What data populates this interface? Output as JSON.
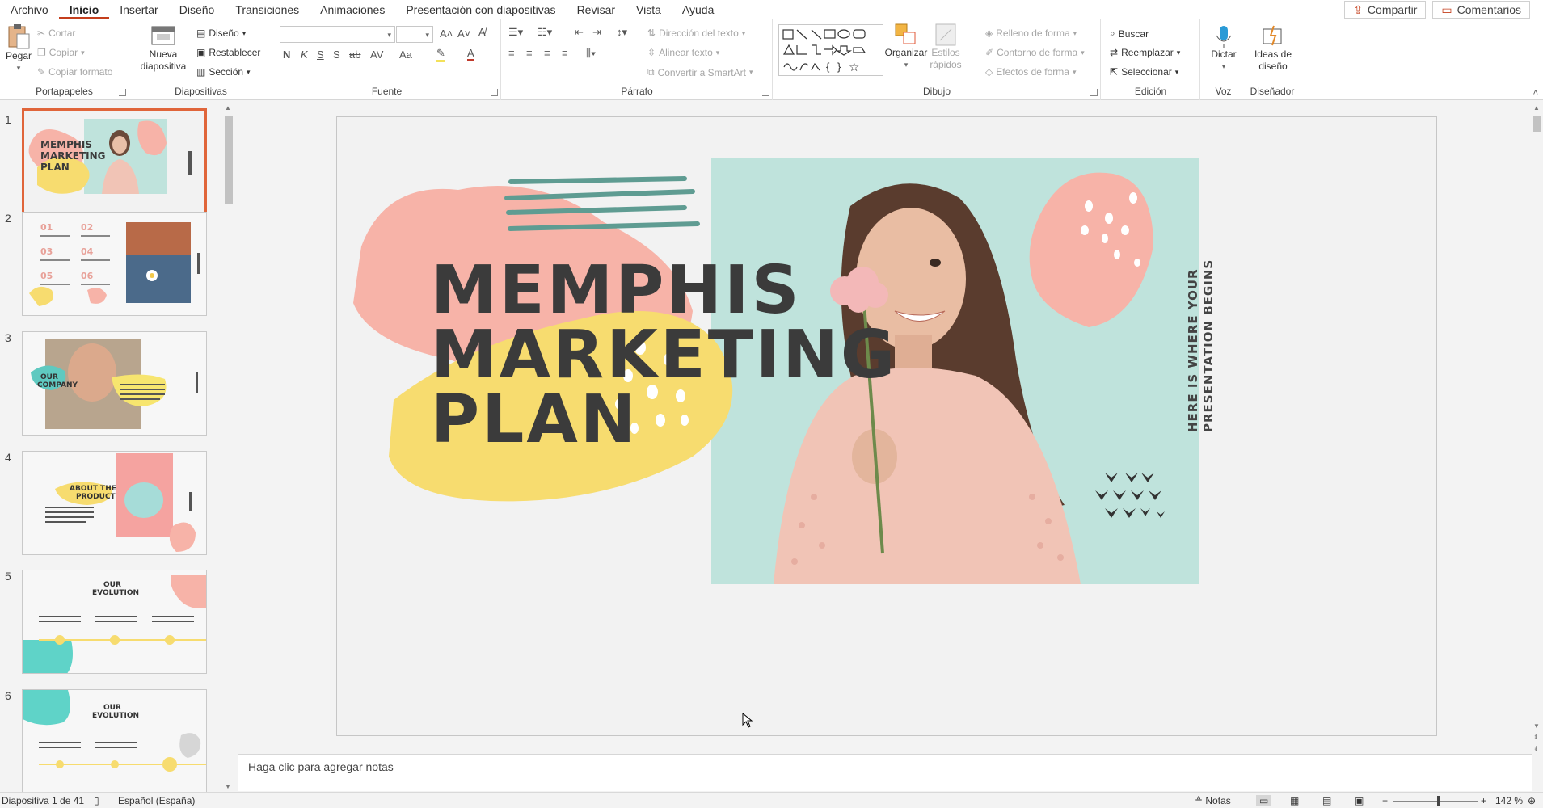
{
  "tabs": [
    "Archivo",
    "Inicio",
    "Insertar",
    "Diseño",
    "Transiciones",
    "Animaciones",
    "Presentación con diapositivas",
    "Revisar",
    "Vista",
    "Ayuda"
  ],
  "active_tab": "Inicio",
  "share": {
    "label": "Compartir",
    "comments": "Comentarios"
  },
  "ribbon": {
    "portapapeles": {
      "label": "Portapapeles",
      "paste": "Pegar",
      "cut": "Cortar",
      "copy": "Copiar",
      "copy_format": "Copiar formato"
    },
    "diapositivas": {
      "label": "Diapositivas",
      "new_slide": "Nueva diapositiva",
      "layout": "Diseño",
      "reset": "Restablecer",
      "section": "Sección"
    },
    "fuente": {
      "label": "Fuente"
    },
    "parrafo": {
      "label": "Párrafo",
      "text_direction": "Dirección del texto",
      "align_text": "Alinear texto",
      "smartart": "Convertir a SmartArt"
    },
    "dibujo": {
      "label": "Dibujo",
      "arrange": "Organizar",
      "quick_styles": "Estilos rápidos",
      "fill": "Relleno de forma",
      "outline": "Contorno de forma",
      "effects": "Efectos de forma"
    },
    "edicion": {
      "label": "Edición",
      "find": "Buscar",
      "replace": "Reemplazar",
      "select": "Seleccionar"
    },
    "voz": {
      "label": "Voz",
      "dictate": "Dictar"
    },
    "disenador": {
      "label": "Diseñador",
      "ideas": "Ideas de diseño"
    }
  },
  "thumbnails": [
    {
      "num": "1",
      "text": "MEMPHIS MARKETING PLAN"
    },
    {
      "num": "2",
      "text": ""
    },
    {
      "num": "3",
      "text": "OUR COMPANY"
    },
    {
      "num": "4",
      "text": "ABOUT THE PRODUCT"
    },
    {
      "num": "5",
      "text": "OUR EVOLUTION"
    },
    {
      "num": "6",
      "text": "OUR EVOLUTION"
    }
  ],
  "slide": {
    "title_lines": [
      "MEMPHIS",
      "MARKETING",
      "PLAN"
    ],
    "side_text_1": "HERE IS WHERE YOUR",
    "side_text_2": "PRESENTATION BEGINS"
  },
  "notes_placeholder": "Haga clic para agregar notas",
  "status": {
    "slide_count": "Diapositiva 1 de 41",
    "language": "Español (España)",
    "notes": "Notas",
    "zoom": "142 %"
  },
  "colors": {
    "pink": "#f7b3a8",
    "yellow": "#f7dc6f",
    "teal": "#5f9c92",
    "mint": "#bfe3dc",
    "accent": "#c43e1c"
  }
}
